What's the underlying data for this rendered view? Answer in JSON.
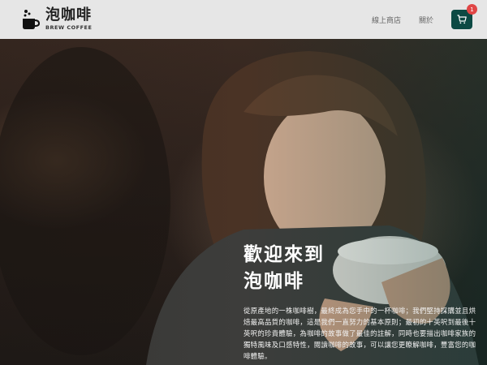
{
  "brand": {
    "name": "泡咖啡",
    "sub": "BREW COFFEE",
    "logo_icon": "coffee-cup-icon"
  },
  "nav": {
    "links": [
      {
        "label": "線上商店"
      },
      {
        "label": "關於"
      }
    ],
    "cart": {
      "icon": "cart-icon",
      "count": "1"
    }
  },
  "hero": {
    "title_line1": "歡迎來到",
    "title_line2": "泡咖啡",
    "description": "從原產地的一株咖啡樹，最終成為您手中的一杯咖啡；我們堅持採購並且烘焙最高品質的咖啡，這是我們一直努力的基本原則；最初的十英呎到最後十英呎的珍貴體驗，為咖啡的故事做了最佳的註解，同時也要描出咖啡家族的獨特風味及口感特性，閱讀咖啡的故事，可以讓您更瞭解咖啡，豐富您的咖啡體驗。"
  },
  "colors": {
    "nav_bg": "#e6e6e6",
    "cart_bg": "#0d4a44",
    "badge_bg": "#e04646"
  }
}
